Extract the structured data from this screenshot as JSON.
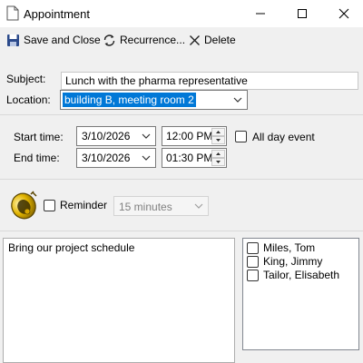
{
  "window": {
    "title": "Appointment",
    "minimize_icon": "minimize-icon",
    "maximize_icon": "maximize-icon",
    "close_icon": "close-icon"
  },
  "toolbar": {
    "save_close_label": "Save and Close",
    "recurrence_label": "Recurrence...",
    "delete_label": "Delete"
  },
  "form": {
    "subject_label": "Subject:",
    "subject_value": "Lunch with the pharma representative",
    "location_label": "Location:",
    "location_value": "building B, meeting room 2",
    "start_label": "Start time:",
    "start_date": "3/10/2026",
    "start_time": "12:00 PM",
    "end_label": "End time:",
    "end_date": "3/10/2026",
    "end_time": "01:30 PM",
    "all_day_label": "All day event",
    "all_day_checked": false,
    "reminder_label": "Reminder",
    "reminder_checked": false,
    "reminder_value": "15 minutes"
  },
  "notes": "Bring our project schedule",
  "attendees": [
    {
      "name": "Miles, Tom",
      "checked": false
    },
    {
      "name": "King, Jimmy",
      "checked": false
    },
    {
      "name": "Tailor, Elisabeth",
      "checked": false
    }
  ],
  "colors": {
    "selection": "#0078d7",
    "bell": "#d8a700"
  }
}
